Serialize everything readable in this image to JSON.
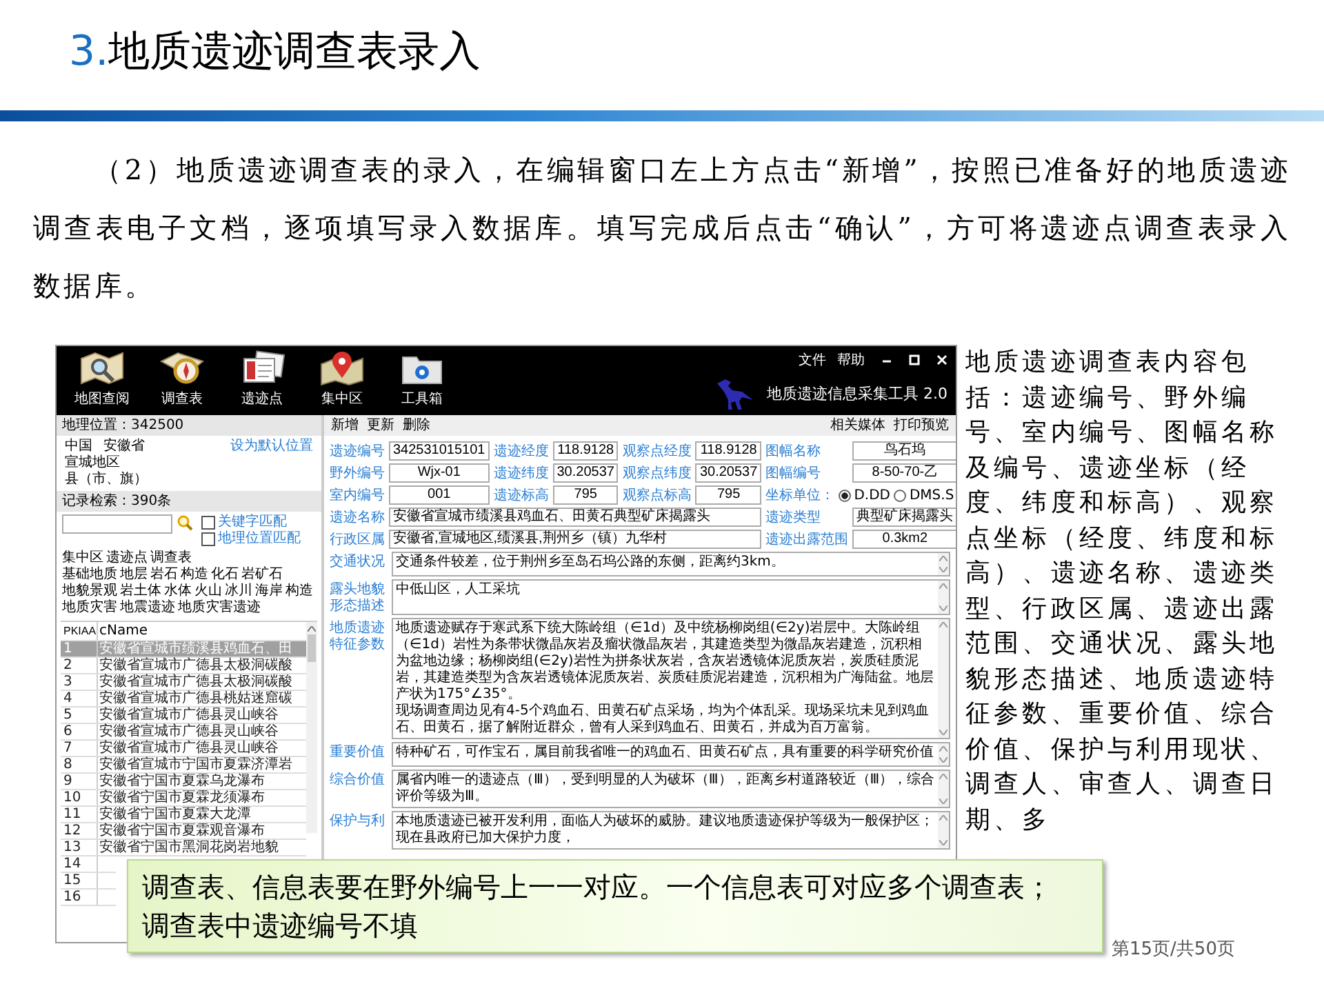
{
  "slide_title": {
    "number": "3.",
    "text": "地质遗迹调查表录入"
  },
  "intro": "（2）地质遗迹调查表的录入，在编辑窗口左上方点击“新增”，按照已准备好的地质遗迹调查表电子文档，逐项填写录入数据库。填写完成后点击“确认”，方可将遗迹点调查表录入数据库。",
  "app": {
    "toolbar": [
      {
        "label": "地图查阅",
        "kind": "map"
      },
      {
        "label": "调查表",
        "kind": "compass"
      },
      {
        "label": "遗迹点",
        "kind": "cards"
      },
      {
        "label": "集中区",
        "kind": "pin"
      },
      {
        "label": "工具箱",
        "kind": "folder"
      }
    ],
    "menu": [
      "文件",
      "帮助"
    ],
    "app_title": "地质遗迹信息采集工具 2.0",
    "location": {
      "header": "地理位置：342500",
      "country": "中国",
      "province": "安徽省",
      "region": "宣城地区",
      "county": "县（市、旗）",
      "set_default": "设为默认位置"
    },
    "search": {
      "header": "记录检索：390条",
      "options": [
        {
          "label": "关键字匹配",
          "checked": false
        },
        {
          "label": "地理位置匹配",
          "checked": false
        }
      ]
    },
    "categories": [
      [
        "集中区",
        "遗迹点",
        "调查表"
      ],
      [
        "基础地质",
        "地层",
        "岩石",
        "构造",
        "化石",
        "岩矿石"
      ],
      [
        "地貌景观",
        "岩土体",
        "水体",
        "火山",
        "冰川",
        "海岸",
        "构造"
      ],
      [
        "地质灾害",
        "地震遗迹",
        "地质灾害遗迹"
      ]
    ],
    "table": {
      "columns": [
        "PKIAA",
        "cName"
      ],
      "rows": [
        {
          "pkiaa": "1",
          "name": "安徽省宣城市绩溪县鸡血石、田",
          "selected": true
        },
        {
          "pkiaa": "2",
          "name": "安徽省宣城市广德县太极洞碳酸",
          "selected": false
        },
        {
          "pkiaa": "3",
          "name": "安徽省宣城市广德县太极洞碳酸",
          "selected": false
        },
        {
          "pkiaa": "4",
          "name": "安徽省宣城市广德县桃姑迷窟碳",
          "selected": false
        },
        {
          "pkiaa": "5",
          "name": "安徽省宣城市广德县灵山峡谷",
          "selected": false
        },
        {
          "pkiaa": "6",
          "name": "安徽省宣城市广德县灵山峡谷",
          "selected": false
        },
        {
          "pkiaa": "7",
          "name": "安徽省宣城市广德县灵山峡谷",
          "selected": false
        },
        {
          "pkiaa": "8",
          "name": "安徽省宣城市宁国市夏霖济潭岩",
          "selected": false
        },
        {
          "pkiaa": "9",
          "name": "安徽省宁国市夏霖乌龙瀑布",
          "selected": false
        },
        {
          "pkiaa": "10",
          "name": "安徽省宁国市夏霖龙须瀑布",
          "selected": false
        },
        {
          "pkiaa": "11",
          "name": "安徽省宁国市夏霖大龙潭",
          "selected": false
        },
        {
          "pkiaa": "12",
          "name": "安徽省宁国市夏霖观音瀑布",
          "selected": false
        },
        {
          "pkiaa": "13",
          "name": "安徽省宁国市黑洞花岗岩地貌",
          "selected": false
        },
        {
          "pkiaa": "14",
          "selected": false
        },
        {
          "pkiaa": "15",
          "selected": false
        },
        {
          "pkiaa": "16",
          "selected": false
        }
      ]
    },
    "form": {
      "actions_left": [
        "新增",
        "更新",
        "删除"
      ],
      "actions_right": [
        "相关媒体",
        "打印预览"
      ],
      "coordinate_rows": [
        [
          {
            "kind": "input",
            "label": "遗迹编号",
            "value": "342531015101"
          },
          {
            "kind": "input",
            "label": "遗迹经度",
            "value": "118.9128"
          },
          {
            "kind": "input",
            "label": "观察点经度",
            "value": "118.9128"
          },
          {
            "kind": "input",
            "label": "图幅名称",
            "value": "鸟石坞"
          }
        ],
        [
          {
            "kind": "input",
            "label": "野外编号",
            "value": "Wjx-01"
          },
          {
            "kind": "input",
            "label": "遗迹纬度",
            "value": "30.20537"
          },
          {
            "kind": "input",
            "label": "观察点纬度",
            "value": "30.20537"
          },
          {
            "kind": "input",
            "label": "图幅编号",
            "value": "8-50-70-乙"
          }
        ],
        [
          {
            "kind": "input",
            "label": "室内编号",
            "value": "001"
          },
          {
            "kind": "input",
            "label": "遗迹标高",
            "value": "795"
          },
          {
            "kind": "input",
            "label": "观察点标高",
            "value": "795"
          },
          {
            "kind": "radio",
            "label": "坐标单位：",
            "options": [
              {
                "label": "D.DD",
                "selected": true
              },
              {
                "label": "DMS.S",
                "selected": false
              }
            ]
          }
        ]
      ],
      "detail_rows": [
        [
          {
            "label": "遗迹名称",
            "value": "安徽省宣城市绩溪县鸡血石、田黄石典型矿床揭露头"
          },
          {
            "label": "遗迹类型",
            "value": "典型矿床揭露头"
          }
        ],
        [
          {
            "label": "行政区属",
            "value": "安徽省,宣城地区,绩溪县,荆州乡（镇）九华村"
          },
          {
            "label": "遗迹出露范围",
            "value": "0.3km2"
          }
        ]
      ],
      "text_areas": [
        {
          "label": "交通状况",
          "paragraphs": [
            "交通条件较差，位于荆州乡至岛石坞公路的东侧，距离约3km。"
          ]
        },
        {
          "label": "露头地貌形态描述",
          "paragraphs": [
            "中低山区，人工采坑"
          ]
        },
        {
          "label": "地质遗迹特征参数",
          "paragraphs": [
            "地质遗迹赋存于寒武系下统大陈岭组（∈1d）及中统杨柳岗组(∈2y)岩层中。大陈岭组（∈1d）岩性为条带状微晶灰岩及瘤状微晶灰岩，其建造类型为微晶灰岩建造，沉积相为盆地边缘；杨柳岗组(∈2y)岩性为拼条状灰岩，含灰岩透镜体泥质灰岩，炭质硅质泥岩，其建造类型为含灰岩透镜体泥质灰岩、炭质硅质泥岩建造，沉积相为广海陆盆。地层产状为175°∠35°。",
            "现场调查周边见有4-5个鸡血石、田黄石矿点采场，均为个体乱采。现场采坑未见到鸡血石、田黄石，据了解附近群众，曾有人采到鸡血石、田黄石，并成为百万富翁。"
          ]
        },
        {
          "label": "重要价值",
          "paragraphs": [
            "特种矿石，可作宝石，属目前我省唯一的鸡血石、田黄石矿点，具有重要的科学研究价值"
          ]
        },
        {
          "label": "综合价值",
          "paragraphs": [
            "属省内唯一的遗迹点（Ⅲ），受到明显的人为破坏（Ⅲ），距离乡村道路较近（Ⅲ），综合评价等级为Ⅲ。"
          ]
        },
        {
          "label": "保护与利",
          "paragraphs": [
            "本地质遗迹已被开发利用，面临人为破坏的威胁。建议地质遗迹保护等级为一般保护区；现在县政府已加大保护力度，"
          ]
        }
      ]
    }
  },
  "side_text": "地质遗迹调查表内容包括：遗迹编号、野外编号、室内编号、图幅名称及编号、遗迹坐标（经度、纬度和标高）、观察点坐标（经度、纬度和标高）、遗迹名称、遗迹类型、行政区属、遗迹出露范围、交通状况、露头地貌形态描述、地质遗迹特征参数、重要价值、综合价值、保护与利用现状、调查人、审查人、调查日期、多",
  "callout": [
    "调查表、信息表要在野外编号上一一对应。一个信息表可对应多个调查表；",
    "调查表中遗迹编号不填"
  ],
  "page_number": "第15页/共50页"
}
